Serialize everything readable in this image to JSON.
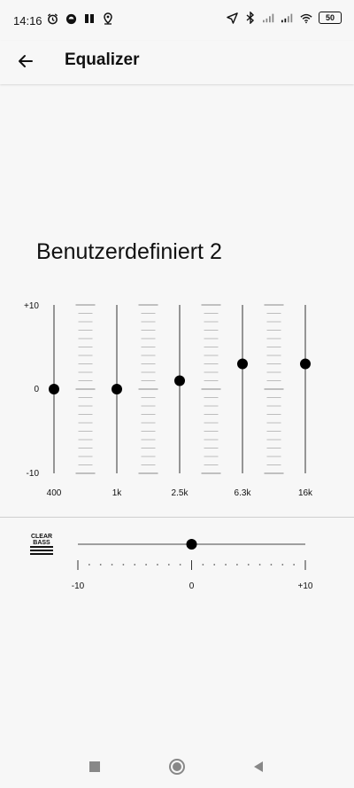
{
  "status_bar": {
    "time": "14:16",
    "battery": "50",
    "left_icons": [
      "alarm-icon",
      "headset-icon",
      "pause-icon",
      "location-pin-icon"
    ],
    "right_icons": [
      "navigation-arrow-icon",
      "bluetooth-icon",
      "signal-icon",
      "signal-icon",
      "wifi-icon",
      "battery-icon"
    ]
  },
  "app_bar": {
    "title": "Equalizer",
    "back_icon": "arrow-left-icon"
  },
  "preset": {
    "name": "Benutzerdefiniert 2"
  },
  "equalizer": {
    "y_max_label": "+10",
    "y_mid_label": "0",
    "y_min_label": "-10",
    "range": [
      -10,
      10
    ],
    "bands": [
      {
        "label": "400",
        "value": 0
      },
      {
        "label": "1k",
        "value": 0
      },
      {
        "label": "2.5k",
        "value": 1
      },
      {
        "label": "6.3k",
        "value": 3
      },
      {
        "label": "16k",
        "value": 3
      }
    ]
  },
  "clear_bass": {
    "logo_text_top": "CLEAR",
    "logo_text_bottom": "BASS",
    "value": 0,
    "range": [
      -10,
      10
    ],
    "min_label": "-10",
    "mid_label": "0",
    "max_label": "+10"
  },
  "nav_bar": {
    "icons": [
      "recents-square-icon",
      "home-circle-icon",
      "back-triangle-icon"
    ]
  }
}
